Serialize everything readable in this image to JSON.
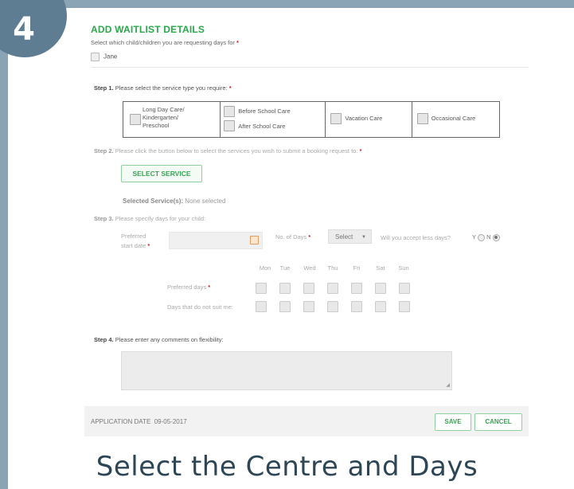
{
  "badge": {
    "number": "4"
  },
  "form": {
    "title": "ADD WAITLIST DETAILS",
    "subtitle": "Select which child/children you are requesting days for",
    "required_mark": "*",
    "child": "Jane",
    "step1": {
      "num": "Step 1.",
      "text": "Please select the service type you require:"
    },
    "service_types": [
      {
        "label": "Long Day Care/ Kindergarten/ Preschool"
      },
      {
        "label": "Before School Care"
      },
      {
        "label": "After School Care"
      },
      {
        "label": "Vacation Care"
      },
      {
        "label": "Occasional Care"
      }
    ],
    "step2": {
      "num": "Step 2.",
      "text": "Please click the button below to select the services you wish to submit a booking request to:"
    },
    "select_service_button": "SELECT SERVICE",
    "selected_services": {
      "label": "Selected Service(s):",
      "value": "None selected"
    },
    "step3": {
      "num": "Step 3.",
      "text": "Please specify days for your child:"
    },
    "preferred_start_line1": "Preferred",
    "preferred_start_line2": "start date",
    "no_of_days_label": "No. of Days",
    "no_of_days_value": "Select",
    "accept_less_label": "Will you accept less days?",
    "yes_label": "Y",
    "no_label": "N",
    "days": [
      "Mon",
      "Tue",
      "Wed",
      "Thu",
      "Fri",
      "Sat",
      "Sun"
    ],
    "preferred_days_label": "Preferred days",
    "unsuitable_days_label": "Days that do not suit me:",
    "step4": {
      "num": "Step 4.",
      "text": "Please enter any comments on flexibility:"
    },
    "application_date_label": "APPLICATION DATE",
    "application_date_value": "09-05-2017",
    "save_button": "SAVE",
    "cancel_button": "CANCEL"
  },
  "caption": "Select the Centre and Days",
  "colors": {
    "frame": "#8aa3b5",
    "badge": "#5f7d92",
    "accent_green": "#2aa84a",
    "required_red": "#c0272d",
    "caption": "#2d4656"
  }
}
